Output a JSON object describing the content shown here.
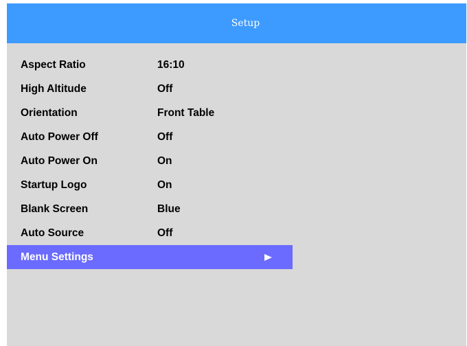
{
  "header": {
    "title": "Setup"
  },
  "menu": {
    "items": [
      {
        "label": "Aspect Ratio",
        "value": "16:10"
      },
      {
        "label": "High Altitude",
        "value": "Off"
      },
      {
        "label": "Orientation",
        "value": "Front Table"
      },
      {
        "label": "Auto Power Off",
        "value": "Off"
      },
      {
        "label": "Auto Power On",
        "value": "On"
      },
      {
        "label": "Startup Logo",
        "value": "On"
      },
      {
        "label": "Blank Screen",
        "value": "Blue"
      },
      {
        "label": "Auto Source",
        "value": "Off"
      },
      {
        "label": "Menu Settings",
        "icon": "submenu-arrow-icon",
        "selected": true
      }
    ]
  },
  "colors": {
    "header_bg": "#3d9bff",
    "panel_bg": "#d9d9d9",
    "selection_bg": "#6b6bff",
    "text": "#000000",
    "selected_text": "#ffffff"
  }
}
